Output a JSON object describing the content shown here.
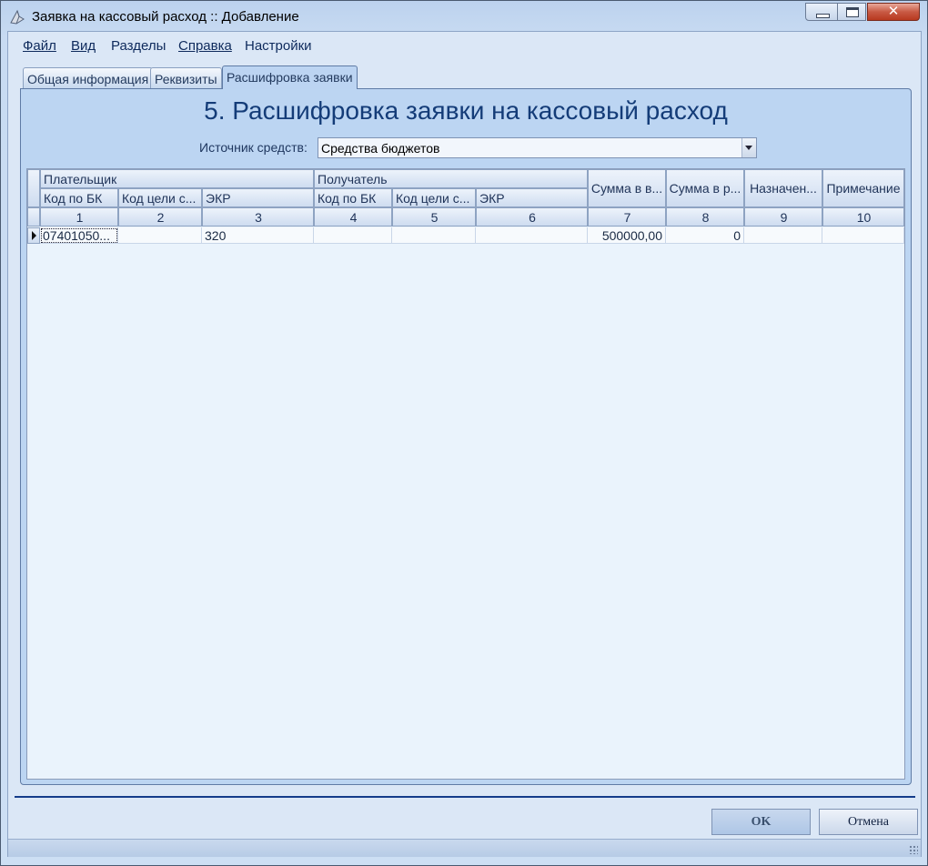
{
  "window": {
    "title": "Заявка на кассовый расход :: Добавление",
    "close_symbol": "✕"
  },
  "menu": [
    {
      "label": "Файл"
    },
    {
      "label": "Вид"
    },
    {
      "label": "Разделы"
    },
    {
      "label": "Справка"
    },
    {
      "label": "Настройки"
    }
  ],
  "tabs": [
    {
      "label": "Общая информация",
      "active": false
    },
    {
      "label": "Реквизиты",
      "active": false
    },
    {
      "label": "Расшифровка заявки",
      "active": true
    }
  ],
  "page": {
    "title": "5. Расшифровка заявки на кассовый расход",
    "source_label": "Источник средств:",
    "source_value": "Средства бюджетов"
  },
  "grid": {
    "groups": {
      "payer": "Плательщик",
      "recipient": "Получатель"
    },
    "headers": {
      "payer_bk": "Код по БК",
      "payer_goal": "Код цели с...",
      "payer_ekr": "ЭКР",
      "rec_bk": "Код по БК",
      "rec_goal": "Код цели с...",
      "rec_ekr": "ЭКР",
      "sum_v": "Сумма в в...",
      "sum_r": "Сумма в р...",
      "purpose": "Назначен...",
      "note": "Примечание"
    },
    "column_numbers": [
      "1",
      "2",
      "3",
      "4",
      "5",
      "6",
      "7",
      "8",
      "9",
      "10"
    ],
    "rows": [
      {
        "payer_bk": "07401050...",
        "payer_goal": "",
        "payer_ekr": "320",
        "rec_bk": "",
        "rec_goal": "",
        "rec_ekr": "",
        "sum_v": "500000,00",
        "sum_r": "0",
        "purpose": "",
        "note": ""
      }
    ]
  },
  "buttons": {
    "ok": "OK",
    "cancel": "Отмена"
  },
  "colors": {
    "accent": "#143c78",
    "separator": "#143c8a"
  }
}
